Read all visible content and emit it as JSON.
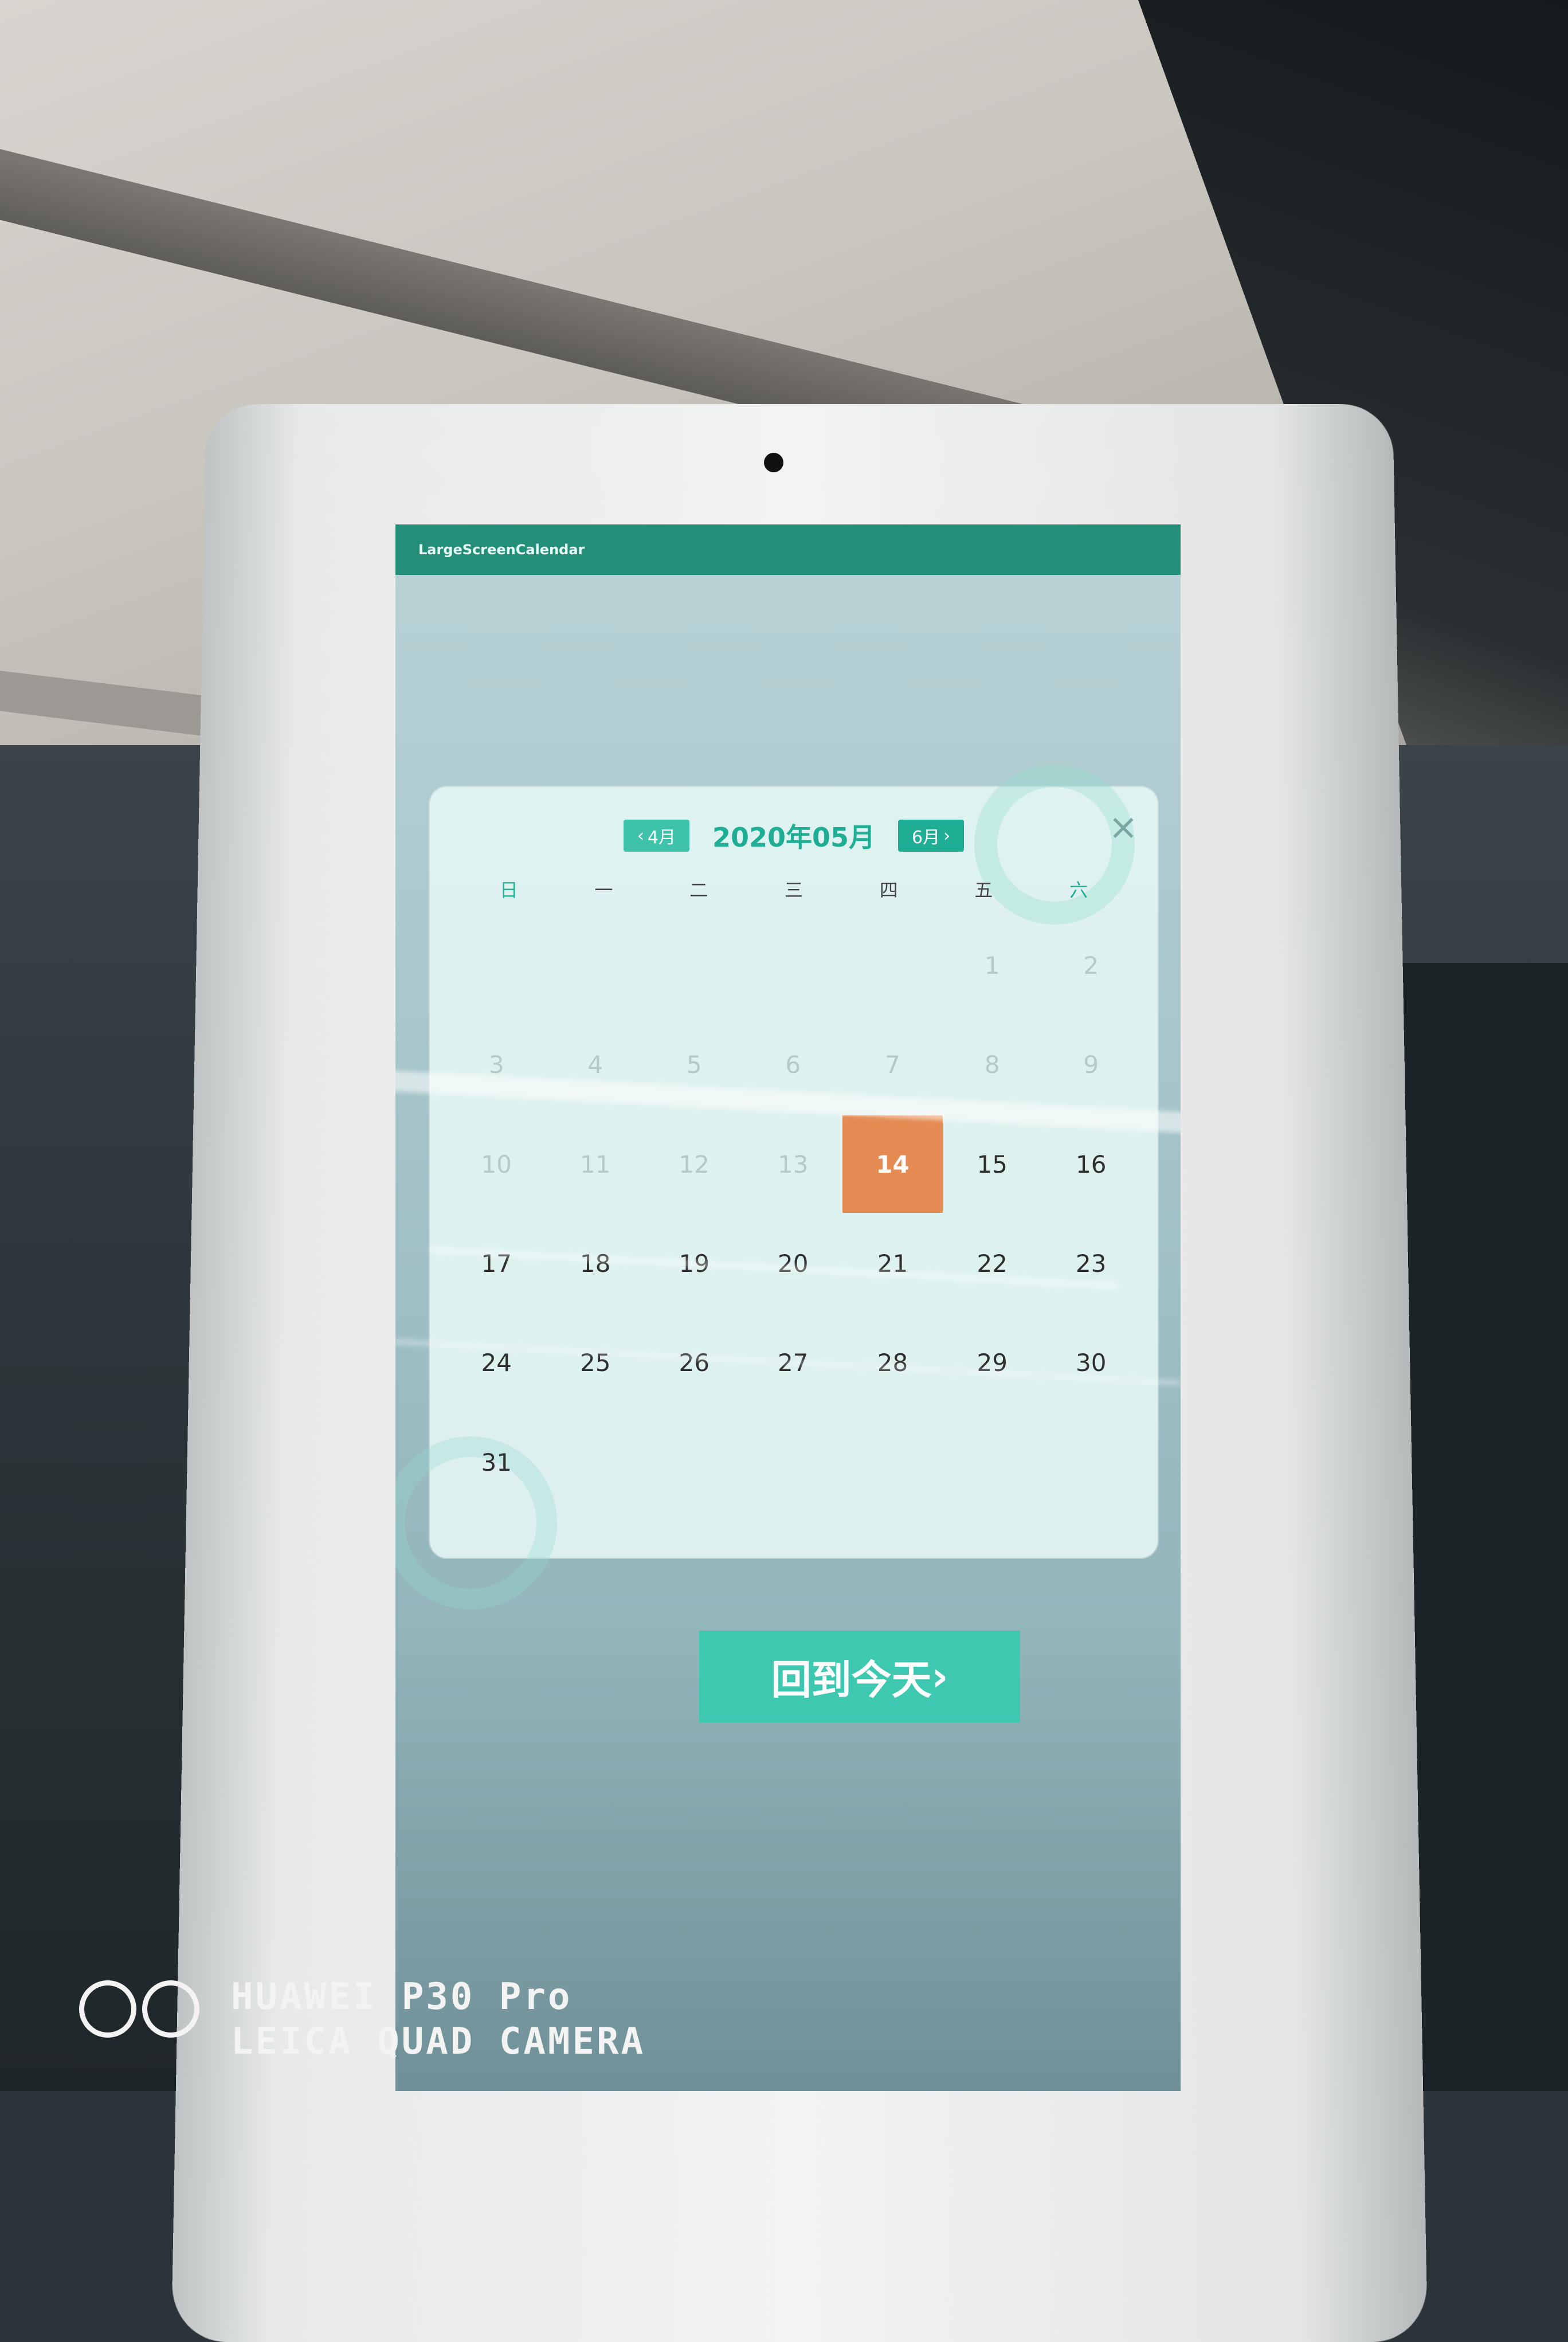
{
  "app_bar": {
    "title": "LargeScreenCalendar"
  },
  "calendar": {
    "prev_month_label": "4月",
    "prev_month_chevron": "‹",
    "title": "2020年05月",
    "next_month_label": "6月",
    "next_month_chevron": "›",
    "close_icon": "×",
    "weekdays": [
      "日",
      "一",
      "二",
      "三",
      "四",
      "五",
      "六"
    ],
    "weekend_color": "#1fae93",
    "today_color": "#e58a52",
    "today_day": 14,
    "weeks": [
      [
        "",
        "",
        "",
        "",
        "",
        "1",
        "2"
      ],
      [
        "3",
        "4",
        "5",
        "6",
        "7",
        "8",
        "9"
      ],
      [
        "10",
        "11",
        "12",
        "13",
        "14",
        "15",
        "16"
      ],
      [
        "17",
        "18",
        "19",
        "20",
        "21",
        "22",
        "23"
      ],
      [
        "24",
        "25",
        "26",
        "27",
        "28",
        "29",
        "30"
      ],
      [
        "31",
        "",
        "",
        "",
        "",
        "",
        ""
      ]
    ]
  },
  "today_button": {
    "label": "回到今天",
    "chevron": "›"
  },
  "watermark": {
    "line1": "HUAWEI P30 Pro",
    "line2": "LEICA QUAD CAMERA"
  }
}
